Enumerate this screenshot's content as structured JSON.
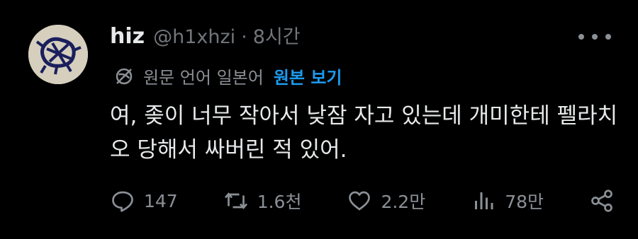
{
  "author": {
    "display_name": "hiz",
    "handle": "@h1xhzi",
    "separator": "·",
    "time": "8시간"
  },
  "translation": {
    "source_label": "원문 언어 일본어",
    "show_original_label": "원본 보기"
  },
  "tweet": {
    "text": "여, 좆이 너무 작아서 낮잠 자고 있는데 개미한테 펠라치오 당해서 싸버린 적 있어."
  },
  "actions": {
    "replies": "147",
    "retweets": "1.6천",
    "likes": "2.2만",
    "views": "78만"
  },
  "icons": [
    "more-icon",
    "translate-icon",
    "reply-icon",
    "retweet-icon",
    "like-icon",
    "views-icon",
    "share-icon"
  ],
  "colors": {
    "background": "#000000",
    "text": "#e7e9ea",
    "muted": "#71767b",
    "link": "#1d9bf0"
  }
}
